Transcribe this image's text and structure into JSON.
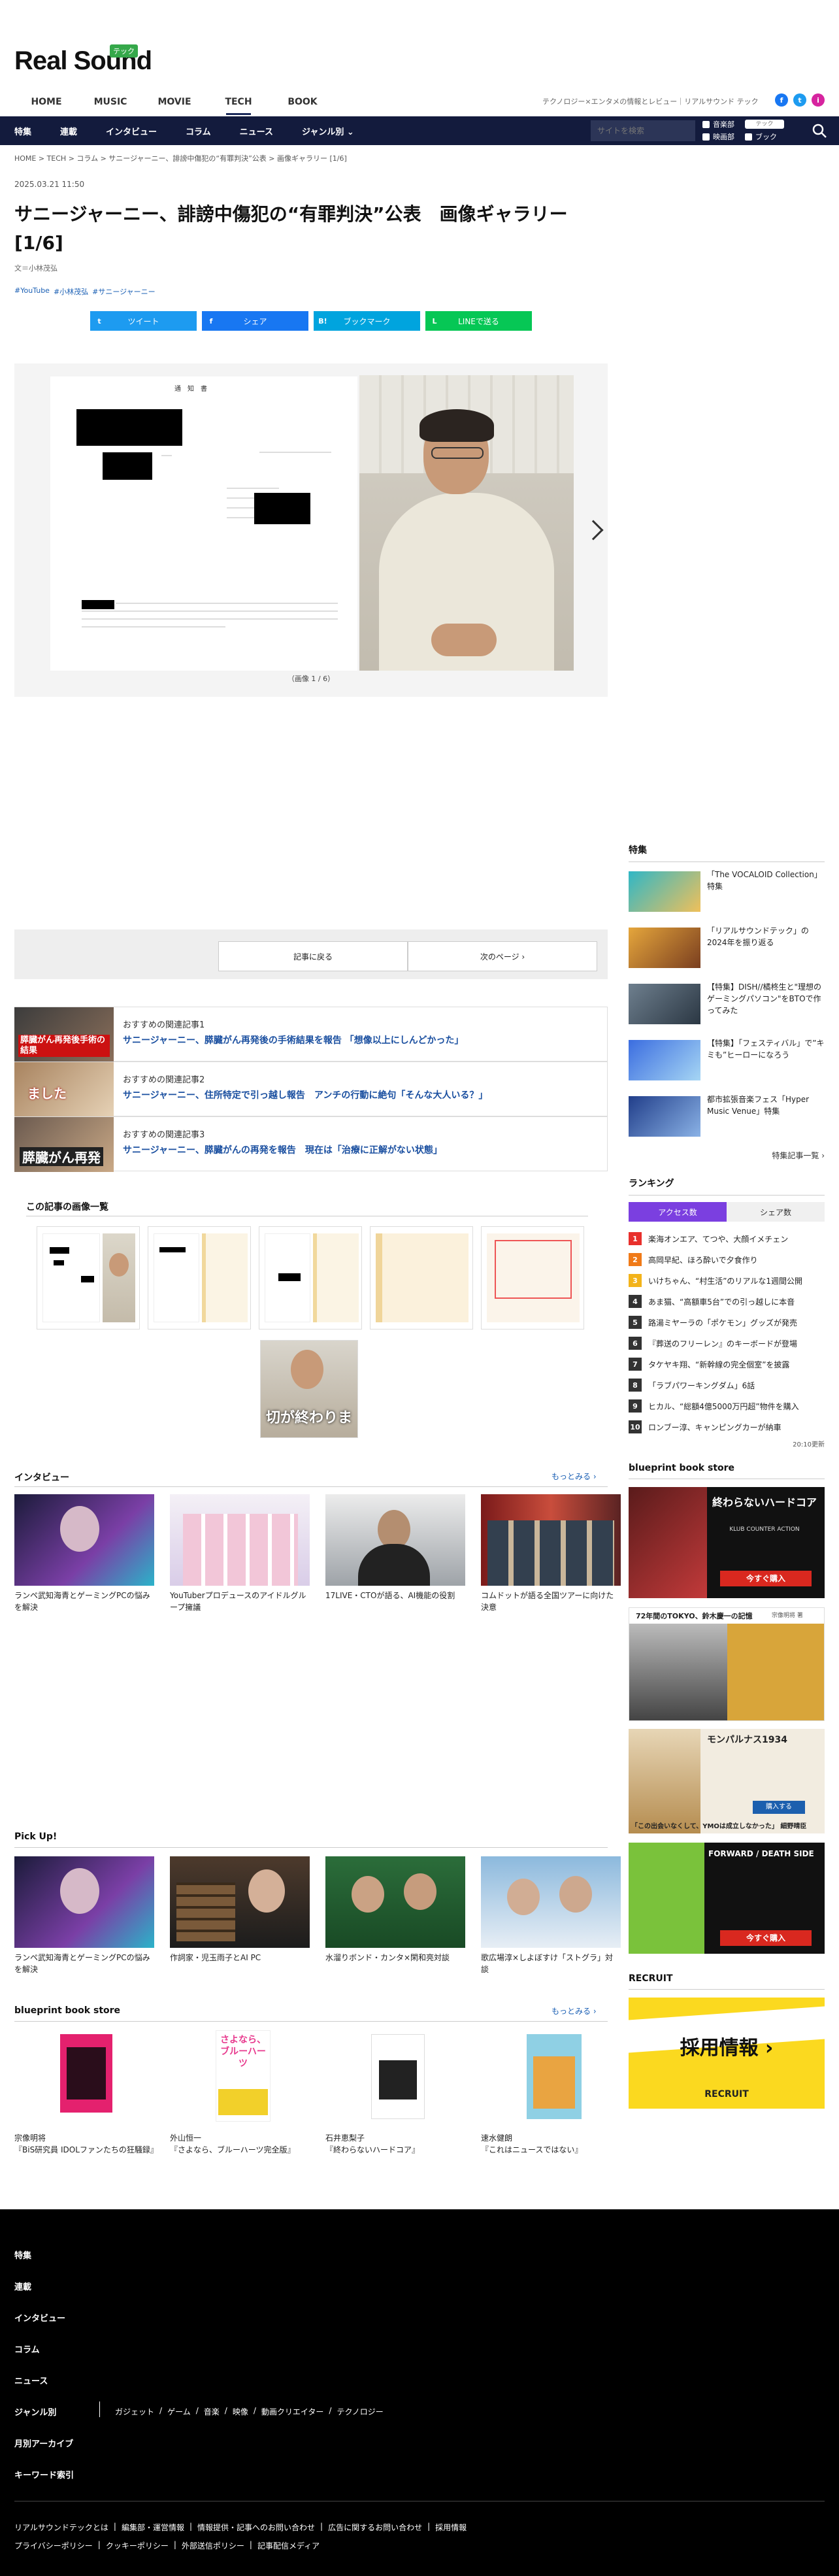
{
  "header": {
    "logo_text": "Real Sound",
    "logo_badge": "テック",
    "top_nav": [
      "HOME",
      "MUSIC",
      "MOVIE",
      "TECH",
      "BOOK"
    ],
    "tagline": "テクノロジー×エンタメの情報とレビュー｜リアルサウンド テック",
    "social": [
      "f",
      "t",
      "i"
    ]
  },
  "navbar": {
    "items": [
      "特集",
      "連載",
      "インタビュー",
      "コラム",
      "ニュース",
      "ジャンル別 ⌄"
    ],
    "search_placeholder": "サイトを検索",
    "filters": [
      "音楽部",
      "テック",
      "映画部",
      "ブック"
    ]
  },
  "breadcrumb": "HOME > TECH > コラム > サニージャーニー、誹謗中傷犯の“有罪判決”公表 > 画像ギャラリー [1/6]",
  "article": {
    "date": "2025.03.21 11:50",
    "title": "サニージャーニー、誹謗中傷犯の“有罪判決”公表　画像ギャラリー [1/6]",
    "author": "文＝小林茂弘",
    "tags": [
      "#YouTube",
      "#小林茂弘",
      "#サニージャーニー"
    ],
    "share": [
      {
        "label": "ツイート",
        "color": "#1d9bf0",
        "icon": "t"
      },
      {
        "label": "シェア",
        "color": "#1877f2",
        "icon": "f"
      },
      {
        "label": "ブックマーク",
        "color": "#00a4de",
        "icon": "B!"
      },
      {
        "label": "LINEで送る",
        "color": "#06c755",
        "icon": "L"
      }
    ]
  },
  "gallery": {
    "caption": "（画像 1 / 6）",
    "doc_title": "通　知　書"
  },
  "pager": {
    "back": "記事に戻る",
    "next": "次のページ ›"
  },
  "related": [
    {
      "num": "おすすめの関連記事1",
      "title": "サニージャーニー、膵臓がん再発後の手術結果を報告 「想像以上にしんどかった」",
      "thumb_text": "膵臓がん再発後手術の結果"
    },
    {
      "num": "おすすめの関連記事2",
      "title": "サニージャーニー、住所特定で引っ越し報告　アンチの行動に絶句「そんな大人いる？」",
      "thumb_text": "ました"
    },
    {
      "num": "おすすめの関連記事3",
      "title": "サニージャーニー、膵臓がんの再発を報告　現在は「治療に正解がない状態」",
      "thumb_text": "膵臓がん再発"
    }
  ],
  "gallery_list_title": "この記事の画像一覧",
  "gallery_last_thumb_text": "切が終わりま",
  "interview": {
    "title": "インタビュー",
    "more": "もっとみる ›",
    "items": [
      "ランペ武知海青とゲーミングPCの悩みを解決",
      "YouTuberプロデュースのアイドルグループ擁議",
      "17LIVE・CTOが語る、AI機能の役割",
      "コムドットが語る全国ツアーに向けた決意"
    ]
  },
  "pickup": {
    "title": "Pick Up!",
    "items": [
      "ランペ武知海青とゲーミングPCの悩みを解決",
      "作詞家・児玉雨子とAI PC",
      "水溜りボンド・カンタ×閑和亮対談",
      "歌広場淳×しよぼすけ「ストグラ」対談"
    ]
  },
  "bookstore": {
    "title": "blueprint book store",
    "more": "もっとみる ›",
    "items": [
      {
        "author": "宗像明将",
        "title": "『BiS研究員 IDOLファンたちの狂騒録』"
      },
      {
        "author": "外山恒一",
        "title": "『さよなら、ブルーハーツ完全版』",
        "cover": "さよなら、ブルーハーツ"
      },
      {
        "author": "石井恵梨子",
        "title": "『終わらないハードコア』"
      },
      {
        "author": "速水健朗",
        "title": "『これはニュースではない』"
      }
    ]
  },
  "sidebar": {
    "featured_title": "特集",
    "featured": [
      "「The VOCALOID Collection」特集",
      "「リアルサウンドテック」の2024年を振り返る",
      "【特集】DISH//橘柊生と\"理想のゲーミングパソコン\"をBTOで作ってみた",
      "【特集】「フェスティバル」で”キミも”ヒーローになろう",
      "都市拡張音楽フェス「Hyper Music Venue」特集"
    ],
    "featured_more": "特集記事一覧 ›",
    "ranking_title": "ランキング",
    "ranking_tabs": [
      "アクセス数",
      "シェア数"
    ],
    "ranking": [
      "楽海オンエア、てつや、大顔イメチェン",
      "高岡早紀、ほろ酔いで夕食作り",
      "いけちゃん、“村生活”のリアルな1週間公開",
      "あま猫、“高額車5台”での引っ越しに本音",
      "路湯ミヤーラの「ポケモン」グッズが発売",
      "『葬送のフリーレン』のキーボードが登場",
      "タケヤキ翔、“新幹線の完全個室”を披露",
      "「ラブパワーキングダム」6話",
      "ヒカル、“総額4億5000万円超”物件を購入",
      "ロンブー淳、キャンピングカーが納車"
    ],
    "ranking_updated": "20:10更新",
    "ranking_colors": [
      "#e8302c",
      "#f07a18",
      "#f3b31a",
      "#333333",
      "#333333",
      "#333333",
      "#333333",
      "#333333",
      "#333333",
      "#333333"
    ],
    "bookstore_title": "blueprint book store",
    "ad1": {
      "title": "終わらないハードコア",
      "sub": "KLUB COUNTER ACTION",
      "btn": "今すぐ購入"
    },
    "ad2": {
      "title": "72年間のTOKYO、鈴木慶一の記憶",
      "author": "宗像明将 著"
    },
    "ad3": {
      "title": "モンパルナス1934",
      "btn": "購入する",
      "note": "「この出会いなくして、YMOは成立しなかった」 細野晴臣"
    },
    "ad4": {
      "title": "FORWARD / DEATH SIDE",
      "btn": "今すぐ購入"
    },
    "recruit_title": "RECRUIT",
    "recruit": {
      "text": "採用情報 ›",
      "sub": "RECRUIT"
    }
  },
  "footer": {
    "links": [
      "特集",
      "連載",
      "インタビュー",
      "コラム",
      "ニュース",
      "ジャンル別",
      "月別アーカイブ",
      "キーワード索引"
    ],
    "genres": [
      "ガジェット",
      "ゲーム",
      "音楽",
      "映像",
      "動画クリエイター",
      "テクノロジー"
    ],
    "bottom1": [
      "リアルサウンドテックとは",
      "編集部・運営情報",
      "情報提供・記事へのお問い合わせ",
      "広告に関するお問い合わせ",
      "採用情報"
    ],
    "bottom2": [
      "プライバシーポリシー",
      "クッキーポリシー",
      "外部送信ポリシー",
      "記事配信メディア"
    ]
  }
}
